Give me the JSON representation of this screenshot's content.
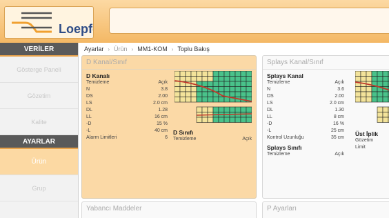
{
  "header": {
    "logo_text": "Loepfe"
  },
  "sidebar": {
    "section1": "VERİLER",
    "items1": [
      "Gösterge Paneli",
      "Gözetim",
      "Kalite"
    ],
    "section2": "AYARLAR",
    "items2": [
      "Ürün",
      "Grup"
    ]
  },
  "breadcrumb": [
    "Ayarlar",
    "Ürün",
    "MM1-KOM",
    "Toplu Bakış"
  ],
  "d_panel": {
    "title": "D Kanal/Sınıf",
    "kanal_title": "D Kanalı",
    "rows": [
      {
        "label": "Temizleme",
        "value": "Açık"
      },
      {
        "label": "N",
        "value": "3.8"
      },
      {
        "label": "DS",
        "value": "2.00"
      },
      {
        "label": "LS",
        "value": "2.0 cm"
      },
      {
        "label": "DL",
        "value": "1.28"
      },
      {
        "label": "LL",
        "value": "16 cm"
      },
      {
        "label": "-D",
        "value": "15 %"
      },
      {
        "label": "-L",
        "value": "40 cm"
      },
      {
        "label": "Alarm Limitleri",
        "value": "6"
      }
    ],
    "sinif_title": "D Sınıfı",
    "sinif_row": {
      "label": "Temizleme",
      "value": "Açık"
    }
  },
  "splays_panel": {
    "title": "Splays Kanal/Sınıf",
    "kanal_title": "Splays Kanal",
    "rows": [
      {
        "label": "Temizleme",
        "value": "Açık"
      },
      {
        "label": "N",
        "value": "3.6"
      },
      {
        "label": "DS",
        "value": "2.00"
      },
      {
        "label": "LS",
        "value": "2.0 cm"
      },
      {
        "label": "DL",
        "value": "1.30"
      },
      {
        "label": "LL",
        "value": "8 cm"
      },
      {
        "label": "-D",
        "value": "16 %"
      },
      {
        "label": "-L",
        "value": "25 cm"
      },
      {
        "label": "Kontrol Uzunluğu",
        "value": "35 cm"
      }
    ],
    "sinif_title": "Splays Sınıfı",
    "sinif_row": {
      "label": "Temizleme",
      "value": "Açık"
    },
    "ust_title": "Üst İplik",
    "ust_rows": [
      "Gözetim",
      "Limit"
    ]
  },
  "bottom_panels": [
    "Yabancı Maddeler",
    "P Ayarları"
  ],
  "colors": {
    "accent": "#f4b865",
    "grid_green": "#49c28a",
    "grid_yellow": "#f3e39a",
    "curve_red": "#c0392b"
  }
}
